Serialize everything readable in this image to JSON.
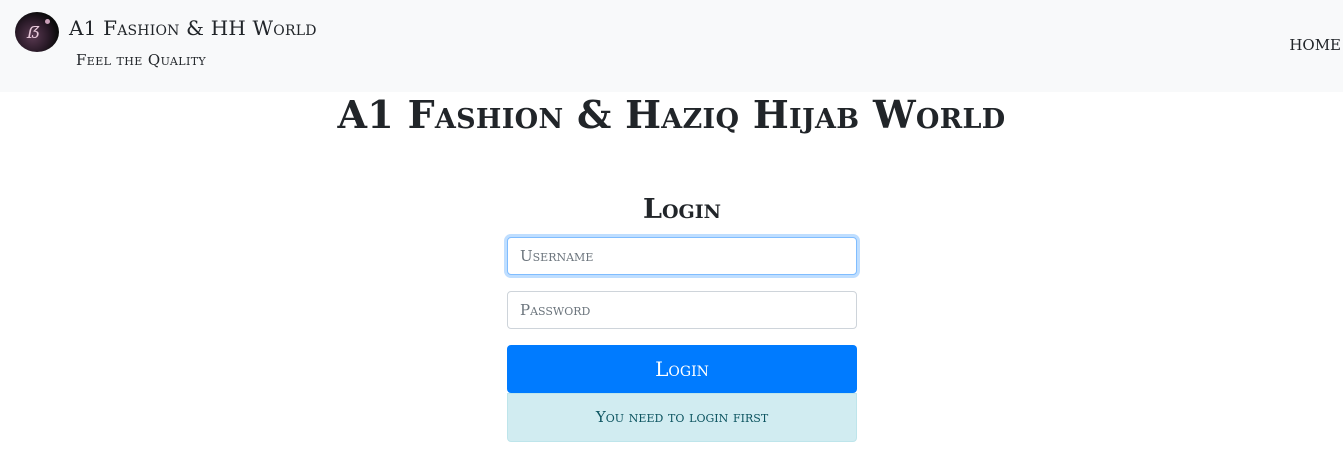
{
  "navbar": {
    "logo_icon": "brand-logo",
    "brand_title": "A1 Fashion & HH World",
    "brand_subtitle": "Feel the Quality",
    "nav_items": [
      {
        "label": "HOME"
      }
    ]
  },
  "main": {
    "page_title": "A1 Fashion & Haziq Hijab World",
    "login": {
      "heading": "Login",
      "username_placeholder": "Username",
      "username_value": "",
      "password_placeholder": "Password",
      "password_value": "",
      "submit_label": "Login",
      "alert_message": "You need to login first"
    }
  },
  "colors": {
    "navbar_bg": "#f8f9fa",
    "primary": "#007bff",
    "info_alert_bg": "#d1ecf1",
    "info_alert_text": "#0c5460",
    "focus_border": "#80bdff"
  }
}
